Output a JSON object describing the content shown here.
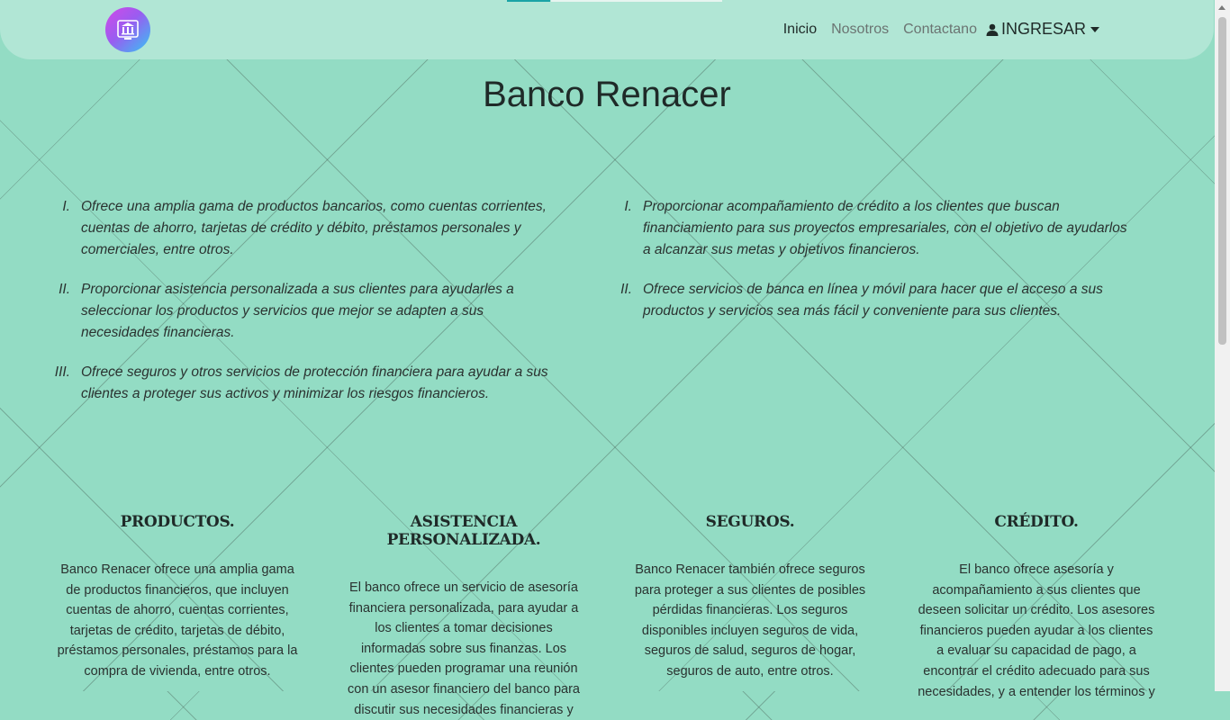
{
  "nav": {
    "links": [
      "Inicio",
      "Nosotros",
      "Contactano"
    ],
    "ingresar": "INGRESAR"
  },
  "title": "Banco Renacer",
  "list_left": [
    {
      "num": "I.",
      "text": "Ofrece una amplia gama de productos bancarios, como cuentas corrientes, cuentas de ahorro, tarjetas de crédito y débito, préstamos personales y comerciales, entre otros."
    },
    {
      "num": "II.",
      "text": "Proporcionar asistencia personalizada a sus clientes para ayudarles a seleccionar los productos y servicios que mejor se adapten a sus necesidades financieras."
    },
    {
      "num": "III.",
      "text": "Ofrece seguros y otros servicios de protección financiera para ayudar a sus clientes a proteger sus activos y minimizar los riesgos financieros."
    }
  ],
  "list_right": [
    {
      "num": "I.",
      "text": "Proporcionar acompañamiento de crédito a los clientes que buscan financiamiento para sus proyectos empresariales, con el objetivo de ayudarlos a alcanzar sus metas y objetivos financieros."
    },
    {
      "num": "II.",
      "text": "Ofrece servicios de banca en línea y móvil para hacer que el acceso a sus productos y servicios sea más fácil y conveniente para sus clientes."
    }
  ],
  "columns": [
    {
      "heading": "PRODUCTOS.",
      "text": "Banco Renacer ofrece una amplia gama de productos financieros, que incluyen cuentas de ahorro, cuentas corrientes, tarjetas de crédito, tarjetas de débito, préstamos personales, préstamos para la compra de vivienda, entre otros."
    },
    {
      "heading": "ASISTENCIA PERSONALIZADA.",
      "text": "El banco ofrece un servicio de asesoría financiera personalizada, para ayudar a los clientes a tomar decisiones informadas sobre sus finanzas. Los clientes pueden programar una reunión con un asesor financiero del banco para discutir sus necesidades financieras y"
    },
    {
      "heading": "SEGUROS.",
      "text": "Banco Renacer también ofrece seguros para proteger a sus clientes de posibles pérdidas financieras. Los seguros disponibles incluyen seguros de vida, seguros de salud, seguros de hogar, seguros de auto, entre otros."
    },
    {
      "heading": "CRÉDITO.",
      "text": "El banco ofrece asesoría y acompañamiento a sus clientes que deseen solicitar un crédito. Los asesores financieros pueden ayudar a los clientes a evaluar su capacidad de pago, a encontrar el crédito adecuado para sus necesidades, y a entender los términos y"
    }
  ]
}
